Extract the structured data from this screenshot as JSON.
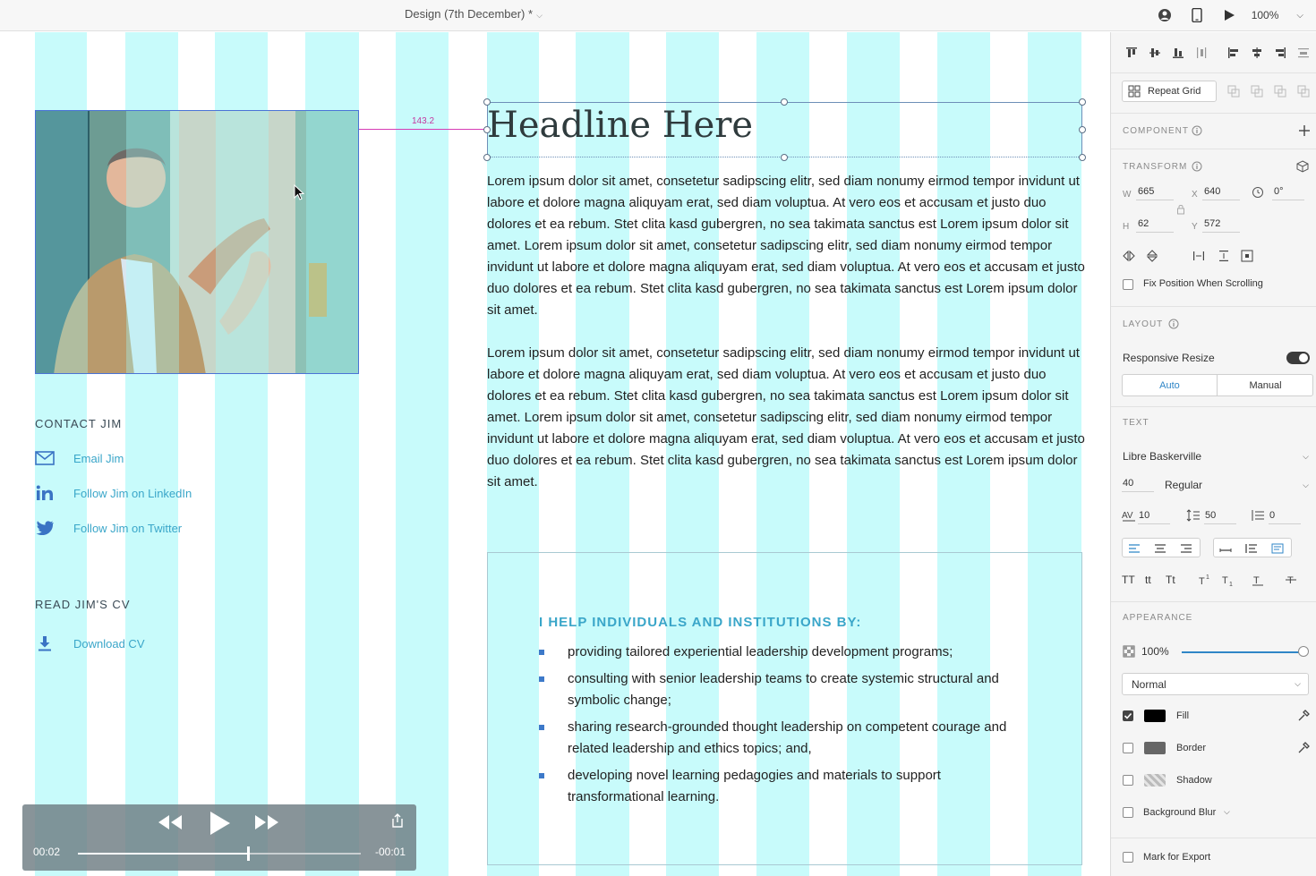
{
  "topbar": {
    "document_title": "Design (7th December) *",
    "zoom": "100%"
  },
  "canvas": {
    "distance_label": "143.2",
    "contact_title": "CONTACT JIM",
    "links": [
      {
        "label": "Email Jim",
        "icon": "mail-icon"
      },
      {
        "label": "Follow Jim on LinkedIn",
        "icon": "linkedin-icon"
      },
      {
        "label": "Follow Jim on Twitter",
        "icon": "twitter-icon"
      }
    ],
    "cv_title": "READ JIM'S CV",
    "cv_link": "Download CV",
    "headline": "Headline Here",
    "paragraph1": "Lorem ipsum dolor sit amet, consetetur sadipscing elitr, sed diam nonumy eirmod tempor invidunt ut labore et dolore magna aliquyam erat, sed diam voluptua. At vero eos et accusam et justo duo dolores et ea rebum. Stet clita kasd gubergren, no sea takimata sanctus est Lorem ipsum dolor sit amet. Lorem ipsum dolor sit amet, consetetur sadipscing elitr, sed diam nonumy eirmod tempor invidunt ut labore et dolore magna aliquyam erat, sed diam voluptua. At vero eos et accusam et justo duo dolores et ea rebum. Stet clita kasd gubergren, no sea takimata sanctus est Lorem ipsum dolor sit amet.",
    "paragraph2": "Lorem ipsum dolor sit amet, consetetur sadipscing elitr, sed diam nonumy eirmod tempor invidunt ut labore et dolore magna aliquyam erat, sed diam voluptua. At vero eos et accusam et justo duo dolores et ea rebum. Stet clita kasd gubergren, no sea takimata sanctus est Lorem ipsum dolor sit amet. Lorem ipsum dolor sit amet, consetetur sadipscing elitr, sed diam nonumy eirmod tempor invidunt ut labore et dolore magna aliquyam erat, sed diam voluptua. At vero eos et accusam et justo duo dolores et ea rebum. Stet clita kasd gubergren, no sea takimata sanctus est Lorem ipsum dolor sit amet.",
    "help_title": "I HELP INDIVIDUALS AND INSTITUTIONS BY:",
    "help_items": [
      "providing tailored experiential leadership development programs;",
      "consulting with senior leadership teams to create systemic structural and symbolic change;",
      "sharing research-grounded thought leadership on competent courage and related leadership and ethics topics; and,",
      "developing novel learning pedagogies and materials to support transformational  learning."
    ]
  },
  "player": {
    "elapsed": "00:02",
    "remaining": "-00:01",
    "progress": 0.6
  },
  "panel": {
    "repeat_grid": "Repeat Grid",
    "component_label": "COMPONENT",
    "transform_label": "TRANSFORM",
    "w_label": "W",
    "w_value": "665",
    "h_label": "H",
    "h_value": "62",
    "x_label": "X",
    "x_value": "640",
    "y_label": "Y",
    "y_value": "572",
    "rotation": "0°",
    "fix_position": "Fix Position When Scrolling",
    "layout_label": "LAYOUT",
    "responsive_resize": "Responsive Resize",
    "responsive_on": true,
    "auto": "Auto",
    "manual": "Manual",
    "text_label": "TEXT",
    "font_family": "Libre Baskerville",
    "font_size": "40",
    "font_weight": "Regular",
    "char_spacing": "10",
    "line_spacing": "50",
    "para_spacing": "0",
    "appearance_label": "APPEARANCE",
    "opacity": "100%",
    "opacity_value": 1.0,
    "blend_mode": "Normal",
    "fill": "Fill",
    "fill_color": "#000000",
    "border": "Border",
    "border_color": "#666666",
    "shadow": "Shadow",
    "background_blur": "Background Blur",
    "mark_export": "Mark for Export",
    "text_transform_tt": "TT",
    "text_transform_lower": "tt",
    "text_transform_title": "Tt"
  },
  "colors": {
    "grid_column": "#c8fbfb",
    "accent": "#3aa6c9",
    "selection": "#6e8fb8",
    "guide": "#d63bb5"
  }
}
